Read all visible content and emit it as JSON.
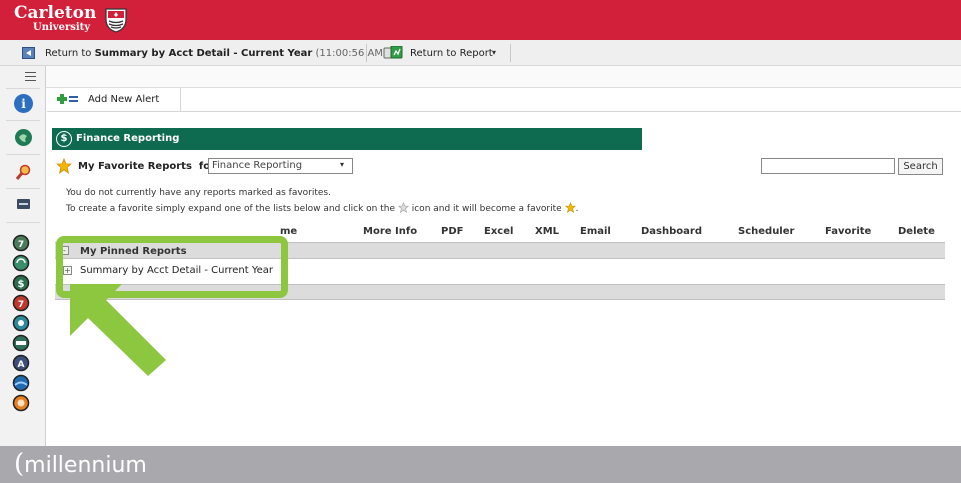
{
  "header": {
    "brand": "Carleton",
    "brand_sub": "University",
    "accent": "#d3203a"
  },
  "topbar": {
    "return_prefix": "Return to ",
    "return_target": "Summary by Acct Detail - Current Year",
    "return_time": "(11:00:56 AM)",
    "return_report_label": "Return to Report",
    "return_report_caret": "▾"
  },
  "alerts": {
    "add_label": "Add New Alert"
  },
  "section": {
    "icon": "$",
    "title": "Finance Reporting",
    "color": "#0e6b4f"
  },
  "favorites": {
    "label": "My Favorite Reports",
    "for_label": "for",
    "selected": "Finance Reporting",
    "select_caret": "▾",
    "message_line1": "You do not currently have any reports marked as favorites.",
    "message_line2a": "To create a favorite simply expand one of the lists below and click on the",
    "message_line2b": "icon and it will become a favorite",
    "message_line2c": "."
  },
  "search": {
    "button_label": "Search",
    "value": ""
  },
  "table": {
    "columns": [
      "me",
      "More Info",
      "PDF",
      "Excel",
      "XML",
      "Email",
      "Dashboard",
      "Scheduler",
      "Favorite",
      "Delete"
    ],
    "group_label": "My Pinned Reports",
    "group_toggle": "-",
    "row_toggle": "+",
    "row_label": "Summary by Acct Detail - Current Year"
  },
  "footer": {
    "paren": "(",
    "logo": "millennium"
  },
  "icons": {
    "left_nav": [
      "info-icon",
      "globe-icon",
      "search-icon",
      "list-icon",
      "report-icons"
    ],
    "highlight_color": "#8dc63f"
  }
}
